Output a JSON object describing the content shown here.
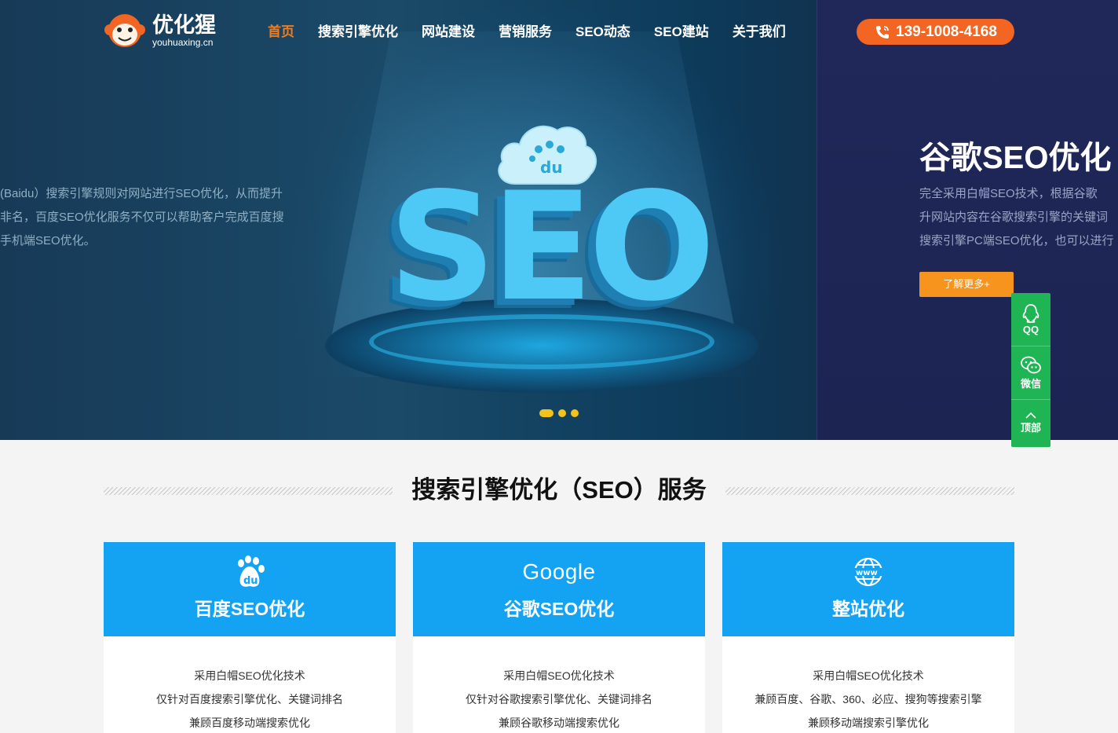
{
  "header": {
    "logo_name": "优化猩",
    "logo_sub": "youhuaxing.cn",
    "nav": [
      "首页",
      "搜索引擎优化",
      "网站建设",
      "营销服务",
      "SEO动态",
      "SEO建站",
      "关于我们"
    ],
    "phone": "139-1008-4168"
  },
  "hero": {
    "left_lines": [
      "(Baidu）搜索引擎规则对网站进行SEO优化，从而提升",
      "非名，百度SEO优化服务不仅可以帮助客户完成百度搜",
      "手机端SEO优化。"
    ],
    "seo_word": "SEO",
    "baidu_cloud_text": "du",
    "right_title": "谷歌SEO优化",
    "right_lines": [
      "完全采用白帽SEO技术，根据谷歌",
      "升网站内容在谷歌搜索引擎的关键词",
      "搜索引擎PC端SEO优化，也可以进行"
    ],
    "more_button": "了解更多+"
  },
  "float": {
    "qq": "QQ",
    "wechat": "微信",
    "top": "顶部"
  },
  "section": {
    "title": "搜索引擎优化（SEO）服务",
    "cards": [
      {
        "title": "百度SEO优化",
        "lines": [
          "采用白帽SEO优化技术",
          "仅针对百度搜索引擎优化、关键词排名",
          "兼顾百度移动端搜索优化"
        ]
      },
      {
        "title": "谷歌SEO优化",
        "brand": "Google",
        "lines": [
          "采用白帽SEO优化技术",
          "仅针对谷歌搜索引擎优化、关键词排名",
          "兼顾谷歌移动端搜索优化"
        ]
      },
      {
        "title": "整站优化",
        "lines": [
          "采用白帽SEO优化技术",
          "兼顾百度、谷歌、360、必应、搜狗等搜索引擎",
          "兼顾移动端搜索引擎优化"
        ]
      }
    ]
  },
  "colors": {
    "accent_orange": "#f26522",
    "nav_active": "#f27c1c",
    "card_blue": "#13a3f2",
    "float_green": "#1fb454",
    "dot_yellow": "#f3c21b"
  }
}
